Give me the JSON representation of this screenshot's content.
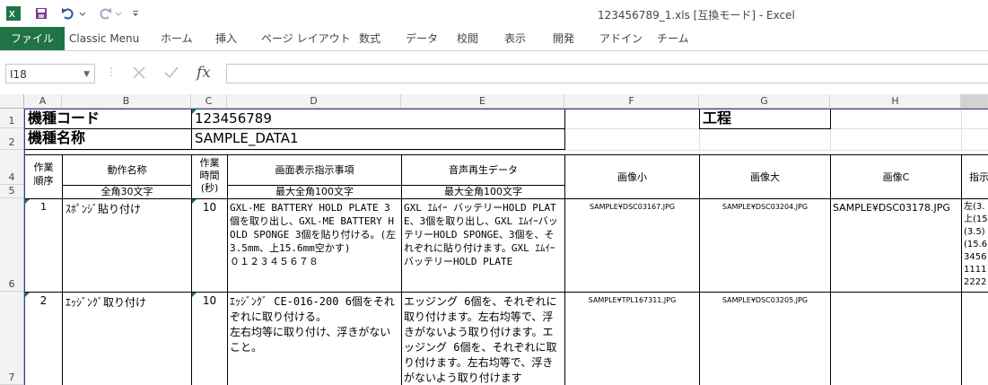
{
  "window": {
    "title": "123456789_1.xls  [互換モード] - Excel"
  },
  "ribbon_tabs": [
    "ファイル",
    "Classic Menu",
    "ホーム",
    "挿入",
    "ページ レイアウト",
    "数式",
    "データ",
    "校閲",
    "表示",
    "開発",
    "アドイン",
    "チーム"
  ],
  "namebox": {
    "value": "I18"
  },
  "formula": {
    "fx": "fx",
    "value": ""
  },
  "columns": [
    "A",
    "B",
    "C",
    "D",
    "E",
    "F",
    "G",
    "H"
  ],
  "rows": [
    "1",
    "2",
    "4",
    "5",
    "6",
    "7"
  ],
  "sheet": {
    "r1": {
      "label_code": "機種コード",
      "code": "123456789",
      "koutei": "工程"
    },
    "r2": {
      "label_name": "機種名称",
      "name": "SAMPLE_DATA1"
    },
    "headers": {
      "a": "作業\n順序",
      "b": "動作名称",
      "b_sub": "全角30文字",
      "c": "作業\n時間\n(秒)",
      "d": "画面表示指示事項",
      "d_sub": "最大全角100文字",
      "e": "音声再生データ",
      "e_sub": "最大全角100文字",
      "f": "画像小",
      "g": "画像大",
      "h": "画像C",
      "i": "指示"
    },
    "row6": {
      "a": "1",
      "b": "ｽﾎﾟﾝｼﾞ貼り付け",
      "c": "10",
      "d": "GXL-ME BATTERY HOLD PLATE 3個を取り出し、GXL-ME BATTERY HOLD SPONGE 3個を貼り付ける。(左3.5mm、上15.6mm空かす)\n０１２３４５６７８",
      "e": "GXL ｴﾑｲｰ バッテリーHOLD PLATE、3個を取り出し、GXL ｴﾑｲｰバッテリーHOLD SPONGE、3個を、それぞれに貼り付けます。GXL ｴﾑｲｰ バッテリーHOLD PLATE",
      "f": "SAMPLE¥DSC03167.JPG",
      "g": "SAMPLE¥DSC03204.JPG",
      "h": "SAMPLE¥DSC03178.JPG",
      "i": "左(3.\n上(15\n(3.5)\n(15.6\n3456\n1111\n2222"
    },
    "row7": {
      "a": "2",
      "b": "ｴｯｼﾞﾝｸﾞ取り付け",
      "c": "10",
      "d": "ｴｯｼﾞﾝｸﾞ CE-016-200 6個をそれぞれに取り付ける。\n左右均等に取り付け、浮きがないこと。",
      "e": "エッジング 6個を、それぞれに取り付けます。左右均等で、浮きがないよう取り付けます。エッジング 6個を、それぞれに取り付けます。左右均等で、浮きがないよう取り付けます",
      "f": "SAMPLE¥TPL167311.JPG",
      "g": "SAMPLE¥DSC03205.JPG",
      "h": ""
    }
  },
  "colors": {
    "excel_green": "#217346",
    "header_bg": "#f3f3f3",
    "grid": "#e1e1e1"
  }
}
